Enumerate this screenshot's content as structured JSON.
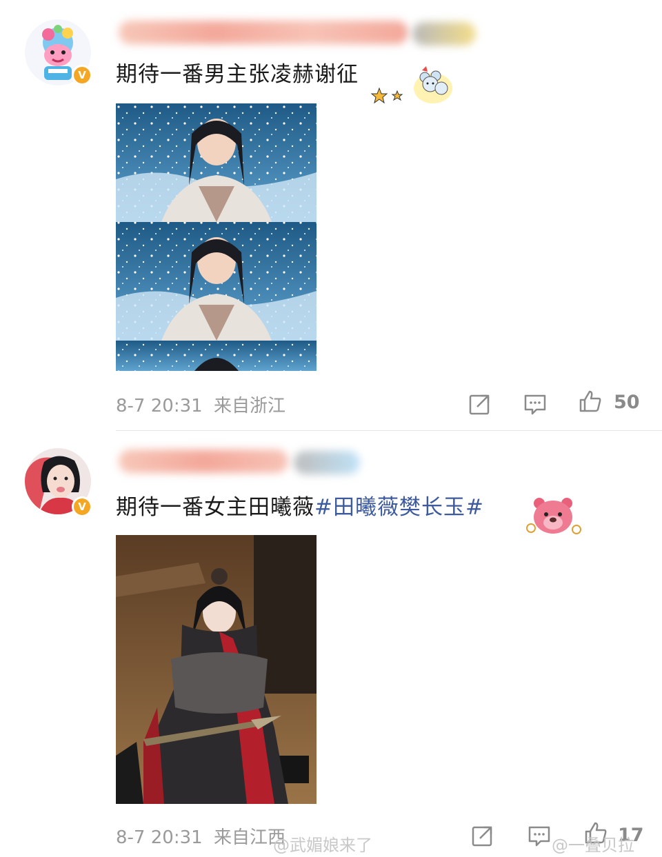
{
  "posts": [
    {
      "text": "期待一番男主张凌赫谢征",
      "hashtag": "",
      "date": "8-7 20:31",
      "location": "来自浙江",
      "likes": "50",
      "icons": [
        "repost-icon",
        "comment-icon",
        "like-icon"
      ],
      "sticker": "mice-sticker"
    },
    {
      "text": "期待一番女主田曦薇",
      "hashtag": "#田曦薇樊长玉#",
      "date": "8-7 20:31",
      "location": "来自江西",
      "likes": "17",
      "icons": [
        "repost-icon",
        "comment-icon",
        "like-icon"
      ],
      "sticker": "strawberry-bear-sticker"
    }
  ],
  "watermarks": {
    "left": "@武媚娘来了",
    "right": "@一叠贝拉"
  },
  "colors": {
    "hashtag": "#3d5a9e",
    "meta": "#9a9a9a",
    "badge": "#f5a623"
  }
}
